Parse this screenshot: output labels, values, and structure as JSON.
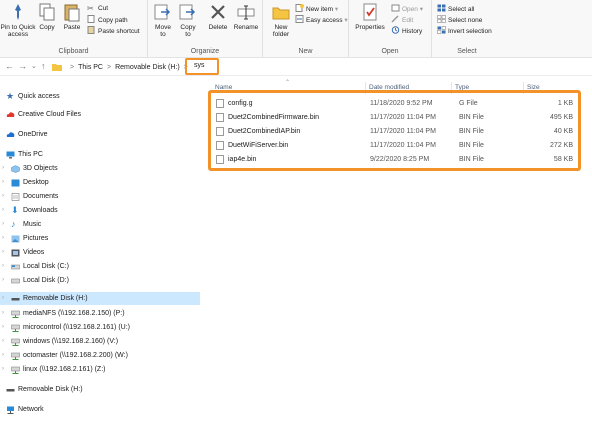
{
  "ribbon": {
    "clipboard": {
      "pin_label": "Pin to Quick access",
      "copy_label": "Copy",
      "paste_label": "Paste",
      "cut_label": "Cut",
      "copy_path_label": "Copy path",
      "paste_shortcut_label": "Paste shortcut",
      "group_label": "Clipboard"
    },
    "organize": {
      "move_to_label": "Move to",
      "copy_to_label": "Copy to",
      "delete_label": "Delete",
      "rename_label": "Rename",
      "group_label": "Organize"
    },
    "new": {
      "new_folder_label": "New folder",
      "new_item_label": "New item",
      "easy_access_label": "Easy access",
      "group_label": "New"
    },
    "open": {
      "properties_label": "Properties",
      "open_label": "Open",
      "edit_label": "Edit",
      "history_label": "History",
      "group_label": "Open"
    },
    "select": {
      "select_all_label": "Select all",
      "select_none_label": "Select none",
      "invert_selection_label": "Invert selection",
      "group_label": "Select"
    }
  },
  "address": {
    "crumbs": [
      "This PC",
      "Removable Disk (H:)",
      "sys"
    ],
    "separator": ">"
  },
  "columns": {
    "name": "Name",
    "date_modified": "Date modified",
    "type": "Type",
    "size": "Size"
  },
  "navpane": {
    "items": [
      {
        "label": "Quick access",
        "icon": "star-icon"
      },
      {
        "label": "Creative Cloud Files",
        "icon": "cloud-icon"
      },
      {
        "label": "OneDrive",
        "icon": "onedrive-icon"
      },
      {
        "label": "This PC",
        "icon": "computer-icon"
      },
      {
        "label": "3D Objects",
        "icon": "cube-folder-icon"
      },
      {
        "label": "Desktop",
        "icon": "desktop-folder-icon"
      },
      {
        "label": "Documents",
        "icon": "documents-folder-icon"
      },
      {
        "label": "Downloads",
        "icon": "downloads-folder-icon"
      },
      {
        "label": "Music",
        "icon": "music-folder-icon"
      },
      {
        "label": "Pictures",
        "icon": "pictures-folder-icon"
      },
      {
        "label": "Videos",
        "icon": "videos-folder-icon"
      },
      {
        "label": "Local Disk (C:)",
        "icon": "drive-icon"
      },
      {
        "label": "Local Disk (D:)",
        "icon": "drive-icon"
      },
      {
        "label": "Removable Disk (H:)",
        "icon": "usb-drive-icon"
      },
      {
        "label": "mediaNFS (\\\\192.168.2.150) (P:)",
        "icon": "network-drive-icon"
      },
      {
        "label": "microcontrol (\\\\192.168.2.161) (U:)",
        "icon": "network-drive-icon"
      },
      {
        "label": "windows (\\\\192.168.2.160) (V:)",
        "icon": "network-drive-icon"
      },
      {
        "label": "octomaster (\\\\192.168.2.200) (W:)",
        "icon": "network-drive-icon"
      },
      {
        "label": "linux (\\\\192.168.2.161) (Z:)",
        "icon": "network-drive-icon"
      },
      {
        "label": "Removable Disk (H:)",
        "icon": "usb-drive-icon"
      },
      {
        "label": "Network",
        "icon": "network-icon"
      }
    ]
  },
  "files": [
    {
      "name": "config.g",
      "date": "11/18/2020 9:52 PM",
      "type": "G File",
      "size": "1 KB"
    },
    {
      "name": "Duet2CombinedFirmware.bin",
      "date": "11/17/2020 11:04 PM",
      "type": "BIN File",
      "size": "495 KB"
    },
    {
      "name": "Duet2CombinedIAP.bin",
      "date": "11/17/2020 11:04 PM",
      "type": "BIN File",
      "size": "40 KB"
    },
    {
      "name": "DuetWiFiServer.bin",
      "date": "11/17/2020 11:04 PM",
      "type": "BIN File",
      "size": "272 KB"
    },
    {
      "name": "iap4e.bin",
      "date": "9/22/2020 8:25 PM",
      "type": "BIN File",
      "size": "58 KB"
    }
  ],
  "colors": {
    "highlight": "#f29229",
    "selected_bg": "#cce8ff"
  }
}
